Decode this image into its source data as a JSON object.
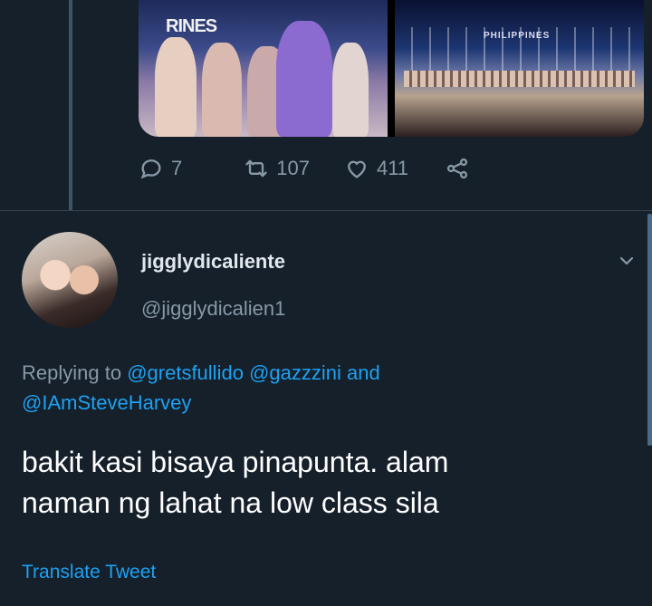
{
  "previous_tweet": {
    "media": {
      "left_sign_text": "RINES",
      "right_sign_text": "PHILIPPINES"
    },
    "actions": {
      "reply_count": "7",
      "retweet_count": "107",
      "like_count": "411"
    }
  },
  "reply_tweet": {
    "display_name": "jigglydicaliente",
    "handle": "@jigglydicalien1",
    "replying_prefix": "Replying to",
    "mentions": [
      "@gretsfullido",
      "@gazzzini",
      "@IAmSteveHarvey"
    ],
    "conjunction": "and",
    "text_line1": "bakit kasi bisaya pinapunta. alam",
    "text_line2": "naman ng lahat na low class sila",
    "translate_label": "Translate Tweet"
  },
  "colors": {
    "background": "#15202b",
    "secondary_text": "#8899a6",
    "link": "#1da1f2",
    "primary_text": "#ffffff"
  }
}
